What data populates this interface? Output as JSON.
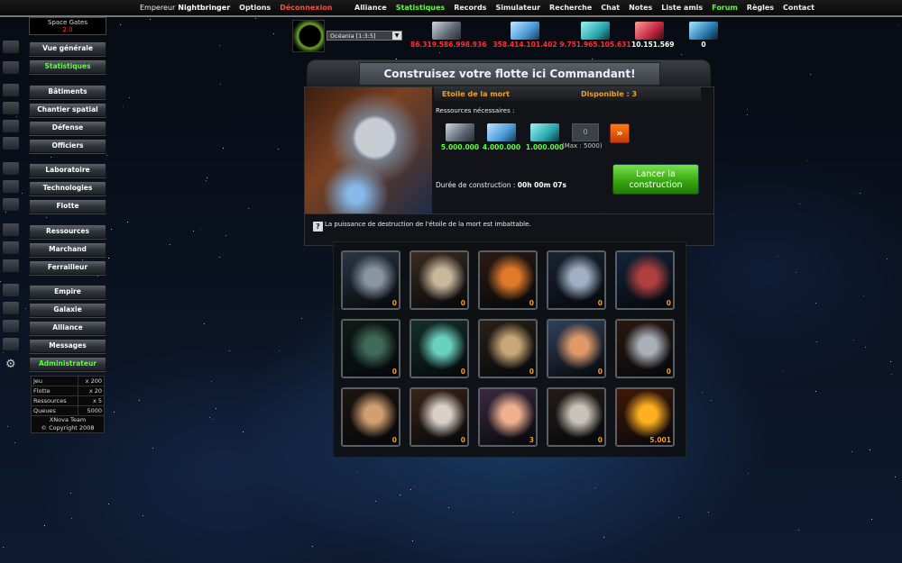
{
  "topbar": {
    "left": [
      {
        "label": "Empereur",
        "style": "plain"
      },
      {
        "label": "Nightbringer",
        "style": "name"
      },
      {
        "label": "Options",
        "style": "normal"
      },
      {
        "label": "Déconnexion",
        "style": "logout"
      }
    ],
    "right": [
      {
        "label": "Alliance",
        "style": "normal"
      },
      {
        "label": "Statistiques",
        "style": "green"
      },
      {
        "label": "Records",
        "style": "normal"
      },
      {
        "label": "Simulateur",
        "style": "normal"
      },
      {
        "label": "Recherche",
        "style": "normal"
      },
      {
        "label": "Chat",
        "style": "normal"
      },
      {
        "label": "Notes",
        "style": "normal"
      },
      {
        "label": "Liste amis",
        "style": "normal"
      },
      {
        "label": "Forum",
        "style": "green"
      },
      {
        "label": "Règles",
        "style": "normal"
      },
      {
        "label": "Contact",
        "style": "normal"
      }
    ]
  },
  "server": {
    "name": "Space Gates",
    "value": "2.0"
  },
  "menu": [
    {
      "label": "Vue générale",
      "active": false
    },
    {
      "label": "Statistiques",
      "active": true
    },
    {
      "label": "Bâtiments",
      "active": false
    },
    {
      "label": "Chantier spatial",
      "active": false
    },
    {
      "label": "Défense",
      "active": false
    },
    {
      "label": "Officiers",
      "active": false
    },
    {
      "label": "Laboratoire",
      "active": false
    },
    {
      "label": "Technologies",
      "active": false
    },
    {
      "label": "Flotte",
      "active": false
    },
    {
      "label": "Ressources",
      "active": false
    },
    {
      "label": "Marchand",
      "active": false
    },
    {
      "label": "Ferrailleur",
      "active": false
    },
    {
      "label": "Empire",
      "active": false
    },
    {
      "label": "Galaxie",
      "active": false
    },
    {
      "label": "Alliance",
      "active": false
    },
    {
      "label": "Messages",
      "active": false
    },
    {
      "label": "Administrateur",
      "active": true
    }
  ],
  "stats": [
    {
      "k": "Jeu",
      "v": "x 200"
    },
    {
      "k": "Flotte",
      "v": "x 20"
    },
    {
      "k": "Ressources",
      "v": "x 5"
    },
    {
      "k": "Queues",
      "v": "5000"
    }
  ],
  "footer": {
    "team": "XNova Team",
    "copyright": "© Copyright 2008"
  },
  "planet": {
    "selected": "Océania [1:3:5]"
  },
  "resources": [
    {
      "icon": "metal-icon",
      "value": "86.319.586.998.936",
      "color": "#ff3030"
    },
    {
      "icon": "crystal-icon",
      "value": "358.414.101.402",
      "color": "#ff3030"
    },
    {
      "icon": "deuterium-icon",
      "value": "9.751.965.105.631",
      "color": "#ff3030"
    },
    {
      "icon": "energy-icon",
      "value": "10.151.569",
      "color": "#ffffff"
    },
    {
      "icon": "darkmatter-icon",
      "value": "0",
      "color": "#ffffff"
    }
  ],
  "main": {
    "title": "Construisez votre flotte ici Commandant!",
    "ship_name": "Etoile de la mort",
    "available": "Disponible : 3",
    "req_label": "Ressources nécessaires :",
    "costs": [
      {
        "icon": "metal-icon",
        "amount": "5.000.000"
      },
      {
        "icon": "crystal-icon",
        "amount": "4.000.000"
      },
      {
        "icon": "deuterium-icon",
        "amount": "1.000.000"
      }
    ],
    "qty_value": "0",
    "max_label": "(Max : 5000)",
    "max_btn": "»",
    "duration_label": "Durée de construction :",
    "duration_value": "00h 00m 07s",
    "launch_line1": "Lancer la",
    "launch_line2": "construction",
    "help_glyph": "?",
    "description": "La puissance de destruction de l'étoile de la mort est imbattable."
  },
  "ships": [
    {
      "count": "0",
      "colors": [
        "#8a95a3",
        "#2a3644"
      ]
    },
    {
      "count": "0",
      "colors": [
        "#c9b79c",
        "#3a2c20"
      ]
    },
    {
      "count": "0",
      "colors": [
        "#e07a2a",
        "#2a1a14"
      ]
    },
    {
      "count": "0",
      "colors": [
        "#9fb0c4",
        "#1a2433"
      ]
    },
    {
      "count": "0",
      "colors": [
        "#b04040",
        "#13243a"
      ]
    },
    {
      "count": "0",
      "colors": [
        "#3f6a5a",
        "#0f1a16"
      ]
    },
    {
      "count": "0",
      "colors": [
        "#6ad0c0",
        "#143028"
      ]
    },
    {
      "count": "0",
      "colors": [
        "#c8a878",
        "#2a2018"
      ]
    },
    {
      "count": "0",
      "colors": [
        "#e09a6a",
        "#30405a"
      ]
    },
    {
      "count": "0",
      "colors": [
        "#aab0b8",
        "#2a1810"
      ]
    },
    {
      "count": "0",
      "colors": [
        "#d0a070",
        "#1c1410"
      ]
    },
    {
      "count": "0",
      "colors": [
        "#d8d0c8",
        "#3a2418"
      ]
    },
    {
      "count": "3",
      "colors": [
        "#f0b090",
        "#3a2a40"
      ]
    },
    {
      "count": "0",
      "colors": [
        "#c8c2b8",
        "#221c18"
      ]
    },
    {
      "count": "5.001",
      "colors": [
        "#ffb020",
        "#401808"
      ]
    }
  ]
}
